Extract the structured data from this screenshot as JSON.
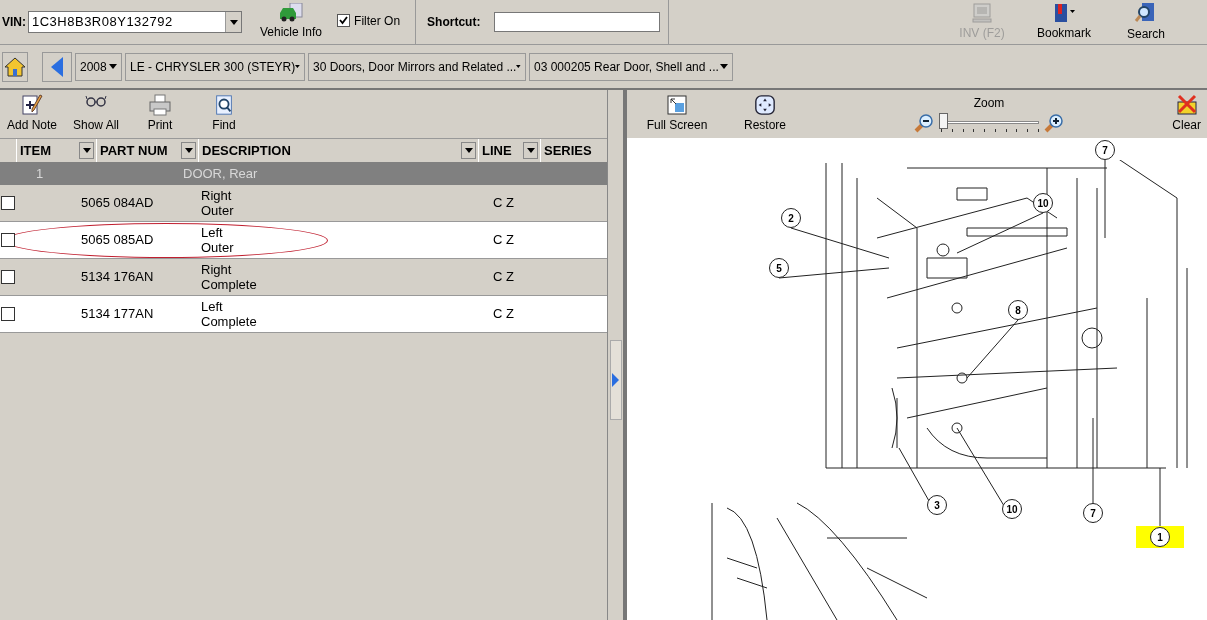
{
  "top_bar": {
    "vin_label": "VIN:",
    "vin_value": "1C3H8B3R08Y132792",
    "vehicle_info": "Vehicle Info",
    "filter": {
      "label": "Filter On",
      "checked": true
    },
    "shortcut_label": "Shortcut:",
    "tools": [
      {
        "kind": "computer",
        "label": "INV (F2)",
        "disabled": true
      },
      {
        "kind": "bookmark",
        "label": "Bookmark",
        "disabled": false
      },
      {
        "kind": "search",
        "label": "Search",
        "disabled": false
      }
    ]
  },
  "nav_bar": {
    "selectors": [
      "2008",
      "LE - CHRYSLER 300 (STEYR)",
      "30 Doors, Door Mirrors and Related  ...",
      "03  000205  Rear Door, Shell and  ..."
    ]
  },
  "left_toolbar": [
    {
      "kind": "note",
      "label": "Add Note"
    },
    {
      "kind": "glasses",
      "label": "Show All"
    },
    {
      "kind": "print",
      "label": "Print"
    },
    {
      "kind": "find",
      "label": "Find"
    }
  ],
  "table": {
    "columns": [
      {
        "label": "ITEM",
        "filter": true
      },
      {
        "label": "PART NUM",
        "filter": true
      },
      {
        "label": "DESCRIPTION",
        "filter": true
      },
      {
        "label": "LINE",
        "filter": true
      },
      {
        "label": "SERIES",
        "filter": false
      }
    ],
    "group": {
      "item": "1",
      "description": "DOOR, Rear"
    },
    "rows": [
      {
        "checked": false,
        "circled": false,
        "part": "5065 084AD",
        "description": [
          "Right",
          "Outer"
        ],
        "line": "C Z"
      },
      {
        "checked": false,
        "circled": true,
        "part": "5065 085AD",
        "description": [
          "Left",
          "Outer"
        ],
        "line": "C Z"
      },
      {
        "checked": false,
        "circled": false,
        "part": "5134 176AN",
        "description": [
          "Right",
          "Complete"
        ],
        "line": "C Z"
      },
      {
        "checked": false,
        "circled": false,
        "part": "5134 177AN",
        "description": [
          "Left",
          "Complete"
        ],
        "line": "C Z"
      }
    ]
  },
  "viewer": {
    "toolbar": [
      {
        "kind": "fullscreen",
        "label": "Full Screen"
      },
      {
        "kind": "restore",
        "label": "Restore"
      }
    ],
    "zoom": {
      "label": "Zoom",
      "level": 0.02
    },
    "clear": "Clear",
    "callouts": [
      {
        "label": "7",
        "highlighted": false
      },
      {
        "label": "10",
        "highlighted": false
      },
      {
        "label": "2",
        "highlighted": false
      },
      {
        "label": "5",
        "highlighted": false
      },
      {
        "label": "8",
        "highlighted": false
      },
      {
        "label": "3",
        "highlighted": false
      },
      {
        "label": "10",
        "highlighted": false
      },
      {
        "label": "7",
        "highlighted": false
      },
      {
        "label": "1",
        "highlighted": true
      }
    ]
  }
}
